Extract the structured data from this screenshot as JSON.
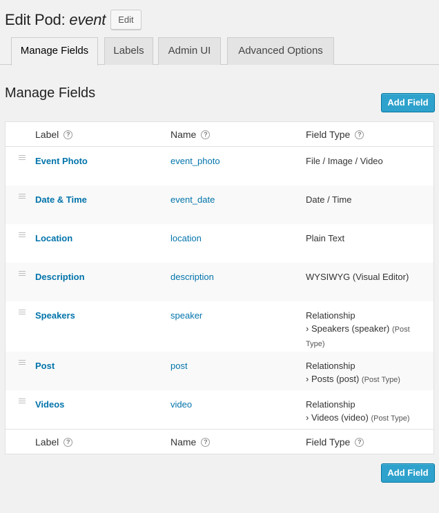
{
  "header": {
    "title_prefix": "Edit Pod: ",
    "title_name": "event",
    "edit_label": "Edit"
  },
  "tabs": [
    {
      "label": "Manage Fields",
      "active": true
    },
    {
      "label": "Labels",
      "active": false
    },
    {
      "label": "Admin UI",
      "active": false
    },
    {
      "label": "Advanced Options",
      "active": false
    }
  ],
  "section": {
    "title": "Manage Fields",
    "add_field_label": "Add Field"
  },
  "table": {
    "columns": [
      "Label",
      "Name",
      "Field Type"
    ],
    "help_icon": "?",
    "rows": [
      {
        "label": "Event Photo",
        "name": "event_photo",
        "type": "File / Image / Video"
      },
      {
        "label": "Date & Time",
        "name": "event_date",
        "type": "Date / Time"
      },
      {
        "label": "Location",
        "name": "location",
        "type": "Plain Text"
      },
      {
        "label": "Description",
        "name": "description",
        "type": "WYSIWYG (Visual Editor)"
      },
      {
        "label": "Speakers",
        "name": "speaker",
        "type": "Relationship",
        "sub": "› Speakers (speaker)",
        "sub_small": "(Post Type)"
      },
      {
        "label": "Post",
        "name": "post",
        "type": "Relationship",
        "sub": "› Posts (post)",
        "sub_small": "(Post Type)"
      },
      {
        "label": "Videos",
        "name": "video",
        "type": "Relationship",
        "sub": "› Videos (video)",
        "sub_small": "(Post Type)"
      }
    ]
  },
  "colors": {
    "link": "#0073aa",
    "primary_button": "#2ea2cc",
    "background": "#f1f1f1"
  }
}
